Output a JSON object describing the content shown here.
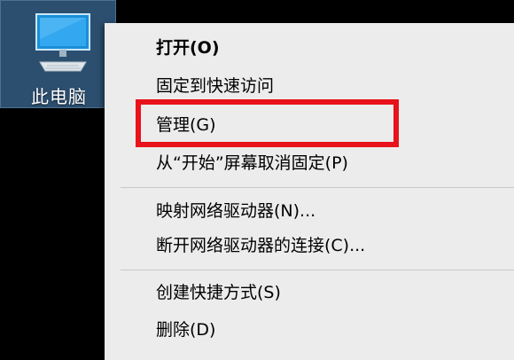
{
  "desktop": {
    "icon_label": "此电脑",
    "icon_name": "computer-monitor-icon"
  },
  "context_menu": {
    "items": [
      {
        "label": "打开(O)",
        "bold": true
      },
      {
        "label": "固定到快速访问",
        "bold": false
      },
      {
        "label": "管理(G)",
        "bold": false
      },
      {
        "label": "从“开始”屏幕取消固定(P)",
        "bold": false
      },
      {
        "label": "映射网络驱动器(N)...",
        "bold": false
      },
      {
        "label": "断开网络驱动器的连接(C)...",
        "bold": false
      },
      {
        "label": "创建快捷方式(S)",
        "bold": false
      },
      {
        "label": "删除(D)",
        "bold": false
      }
    ]
  },
  "colors": {
    "desktop_background": "#000000",
    "selected_icon_background": "#2c4f70",
    "menu_background": "#ececec",
    "highlight_border": "#e8131b"
  }
}
